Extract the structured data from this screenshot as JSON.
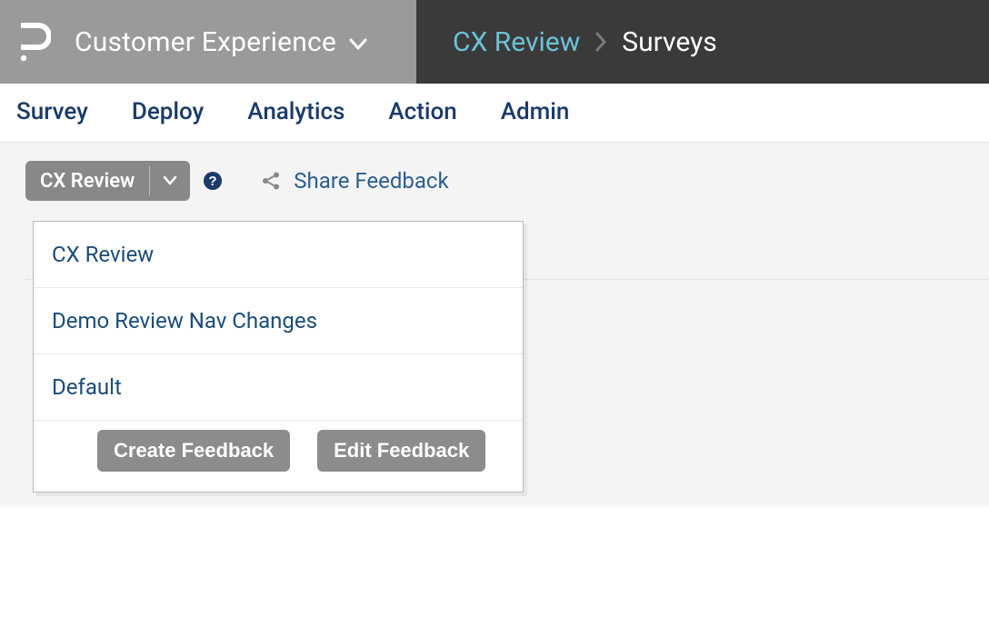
{
  "header": {
    "product_name": "Customer Experience",
    "breadcrumb": {
      "parent": "CX Review",
      "current": "Surveys"
    }
  },
  "nav": {
    "tabs": [
      "Survey",
      "Deploy",
      "Analytics",
      "Action",
      "Admin"
    ]
  },
  "toolbar": {
    "dropdown_label": "CX Review",
    "share_label": "Share Feedback"
  },
  "dropdown": {
    "items": [
      "CX Review",
      "Demo Review Nav Changes",
      "Default"
    ],
    "create_label": "Create Feedback",
    "edit_label": "Edit Feedback"
  },
  "colors": {
    "nav_link": "#1b3a6b",
    "breadcrumb_active": "#6cc1d6",
    "grey_btn": "#888888"
  }
}
